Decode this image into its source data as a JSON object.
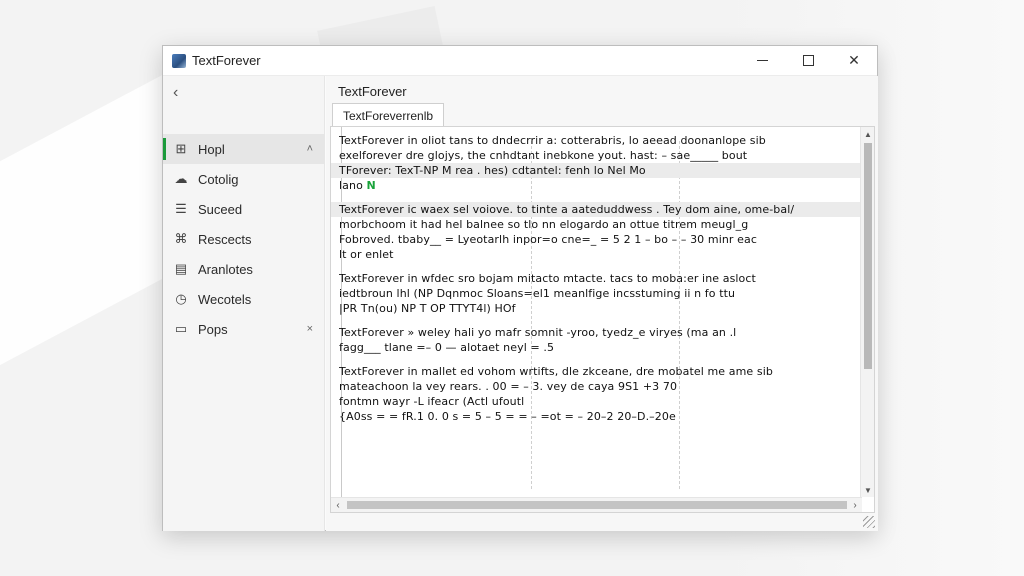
{
  "window": {
    "title": "TextForever",
    "icon": "app-icon",
    "controls": {
      "minimize": "minimize-icon",
      "maximize": "maximize-icon",
      "close": "✕"
    }
  },
  "sidebar": {
    "back": "‹",
    "items": [
      {
        "label": "Hopl",
        "icon": "home-icon",
        "glyph": "⊞",
        "trail": "˄",
        "active": true
      },
      {
        "label": "Cotolig",
        "icon": "cloud-icon",
        "glyph": "☁",
        "trail": ""
      },
      {
        "label": "Suceed",
        "icon": "list-icon",
        "glyph": "☰",
        "trail": ""
      },
      {
        "label": "Rescects",
        "icon": "tag-icon",
        "glyph": "⌘",
        "trail": ""
      },
      {
        "label": "Aranlotes",
        "icon": "document-icon",
        "glyph": "▤",
        "trail": ""
      },
      {
        "label": "Wecotels",
        "icon": "clock-icon",
        "glyph": "◷",
        "trail": ""
      },
      {
        "label": "Pops",
        "icon": "image-icon",
        "glyph": "▭",
        "trail": "×"
      }
    ]
  },
  "main": {
    "title": "TextForever",
    "tab": "TextForeverrenlb"
  },
  "editor": {
    "lines": [
      "TextForever in oliot tans to dndecrrir a: cotterabris, lo aeead doonanlope sib",
      "exelforever dre glojys,  the cnhdtant inebkone yout. hast: – sae_____ bout",
      "TForever: TexT-NP M rea . hes) cdtantel: fenh  lo Nel Mo",
      "lano  N",
      "TextForever ic waex sel voiove. to tinte a aateduddwess . Tey dom aine, ome-bal/",
      "morbchoom it had hel balnee so tlo nn elogardo an ottue titrem meugl_g",
      "Fobroved. tbaby__ = Lyeotarlh inpor=o cne=_ = 5 2 1 – bo – – 30 minr eac",
      "lt or enlet",
      "TextForever in wfdec sro bojam mitacto mtacte. tacs to moba:er ine asloct",
      "iedtbroun lhl (NP Dqnmoc Sloans=el1   meanlfige incsstuming ii n fo ttu",
      "|PR Tn(ou) NP T OP TTYT4l) HOf",
      "TextForever »  weley hali yo mafr somnit -yroo, tyedz_e  viryes  (ma an .l",
      "fagg___ tlane =– 0  —  alotaet                                                         neyl  = .5",
      "TextForever in mallet ed vohom wrtifts, dle zkceane, dre mobatel me ame sib",
      "mateachoon la vey rears. .  00   = – 3.   vey   de  caya  9S1 +3 70",
      "fontmn wayr -L ifeacr (Actl ufoutl",
      "{A0ss = = fR.1 0.        0  s   = 5 – 5        = = – =ot  = – 20–2       20–D.–20e"
    ],
    "highlight_index": 2,
    "cursor_marker": "N"
  },
  "scrollbars": {
    "up": "▲",
    "down": "▼",
    "left": "‹",
    "right": "›"
  }
}
